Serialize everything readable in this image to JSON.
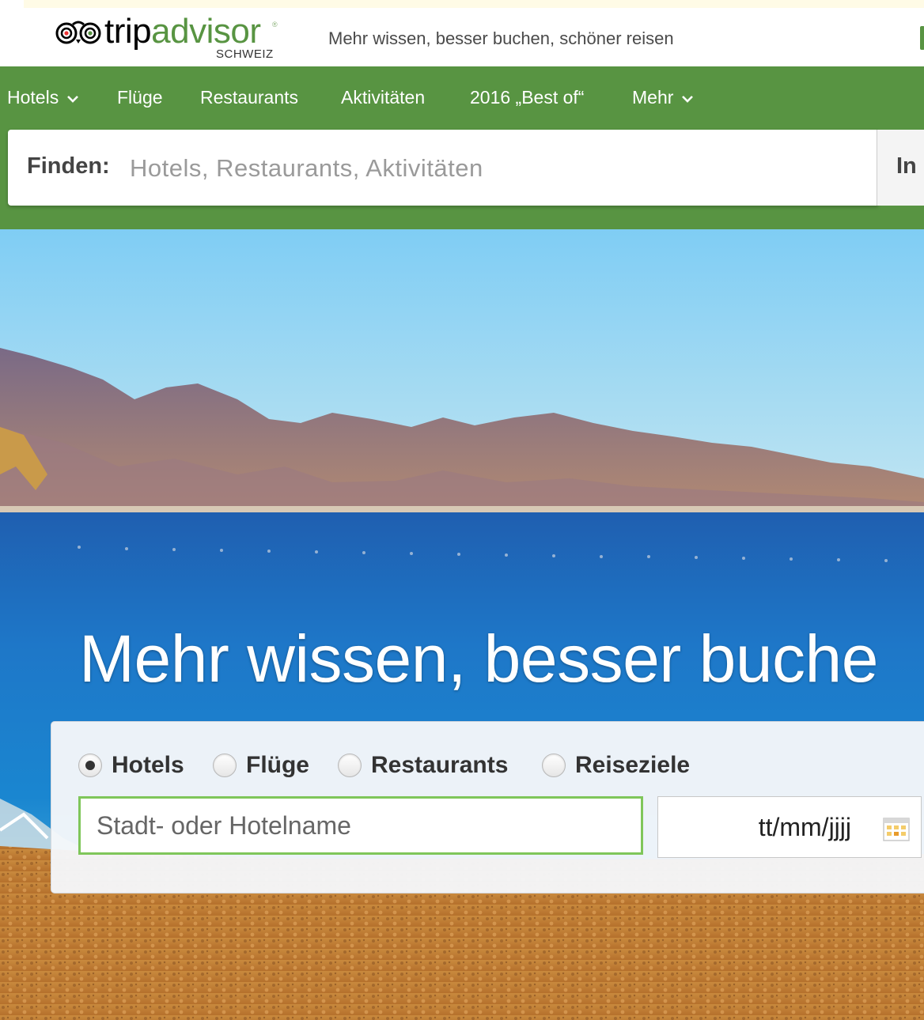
{
  "header": {
    "logo_trip": "trip",
    "logo_advisor": "advisor",
    "logo_registered": "®",
    "logo_country": "SCHWEIZ",
    "tagline": "Mehr wissen, besser buchen, schöner reisen"
  },
  "nav": {
    "items": [
      {
        "label": "Hotels",
        "has_dropdown": true
      },
      {
        "label": "Flüge",
        "has_dropdown": false
      },
      {
        "label": "Restaurants",
        "has_dropdown": false
      },
      {
        "label": "Aktivitäten",
        "has_dropdown": false
      },
      {
        "label": "2016 „Best of“",
        "has_dropdown": false
      },
      {
        "label": "Mehr",
        "has_dropdown": true
      }
    ]
  },
  "search_bar": {
    "label": "Finden:",
    "placeholder": "Hotels, Restaurants, Aktivitäten",
    "in_label": "In"
  },
  "hero": {
    "title": "Mehr wissen, besser buche"
  },
  "search_card": {
    "options": [
      {
        "label": "Hotels",
        "selected": true
      },
      {
        "label": "Flüge",
        "selected": false
      },
      {
        "label": "Restaurants",
        "selected": false
      },
      {
        "label": "Reiseziele",
        "selected": false
      }
    ],
    "city_placeholder": "Stadt- oder Hotelname",
    "date_placeholder": "tt/mm/jjjj"
  },
  "colors": {
    "brand_green": "#589442",
    "input_focus_green": "#7fc65a"
  }
}
